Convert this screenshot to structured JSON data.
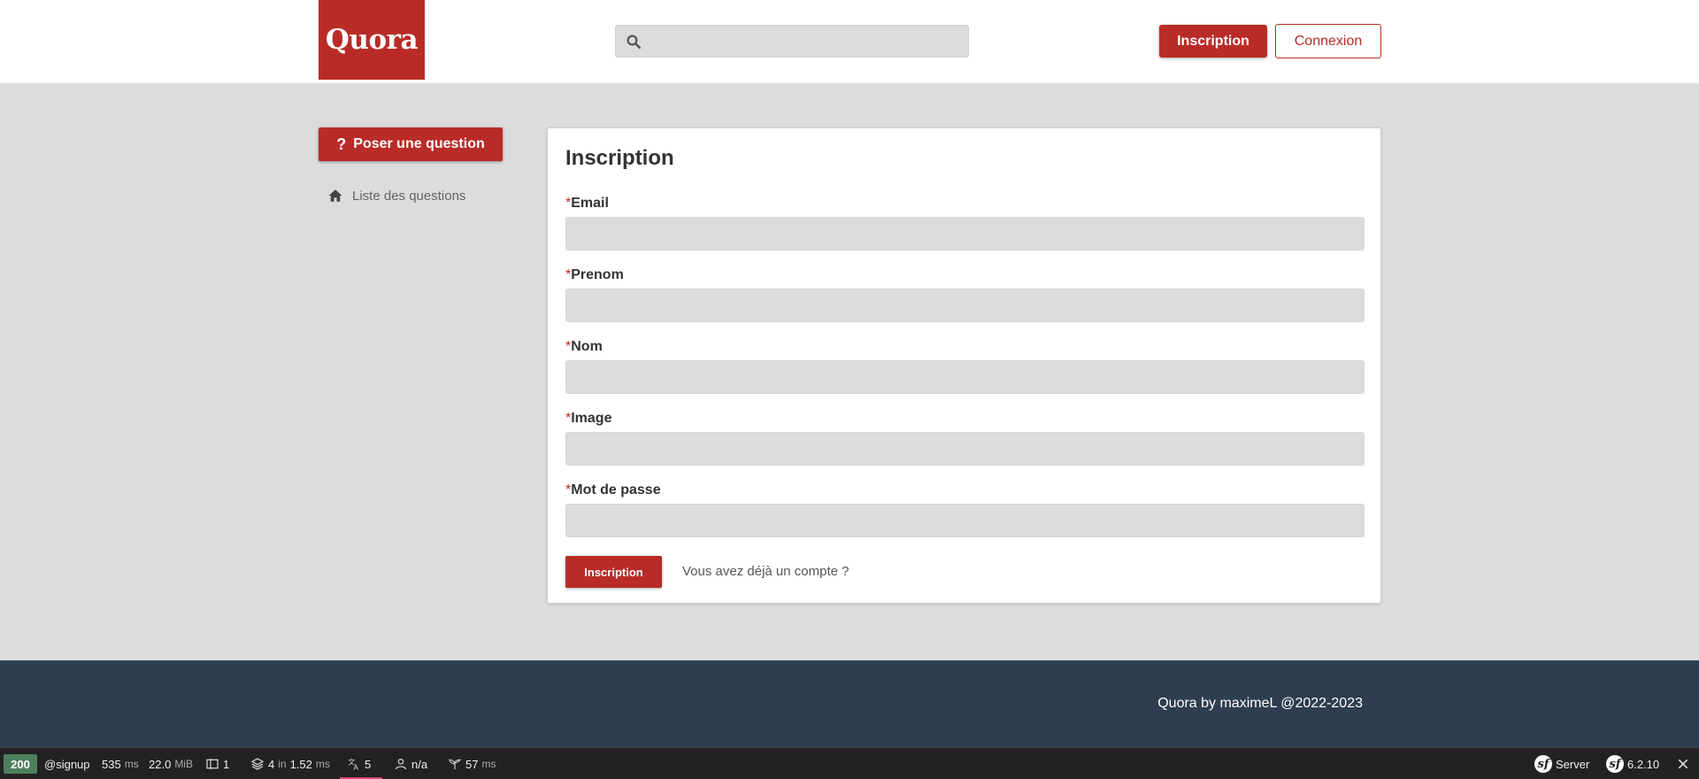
{
  "header": {
    "logo_text": "Quora",
    "search_placeholder": "",
    "signup_label": "Inscription",
    "login_label": "Connexion"
  },
  "sidebar": {
    "ask_question_icon": "?",
    "ask_question_label": "Poser une question",
    "nav_items": [
      {
        "icon": "home-icon",
        "label": "Liste des questions"
      }
    ]
  },
  "form": {
    "title": "Inscription",
    "required_marker": "*",
    "fields": [
      {
        "label": "Email",
        "value": ""
      },
      {
        "label": "Prenom",
        "value": ""
      },
      {
        "label": "Nom",
        "value": ""
      },
      {
        "label": "Image",
        "value": ""
      },
      {
        "label": "Mot de passe",
        "value": ""
      }
    ],
    "submit_label": "Inscription",
    "login_link": "Vous avez déjà un compte ?"
  },
  "footer": {
    "text": "Quora by maximeL @2022-2023"
  },
  "debug_toolbar": {
    "status_code": "200",
    "route": "@signup",
    "time_value": "535",
    "time_unit": "ms",
    "memory_value": "22.0",
    "memory_unit": "MiB",
    "forms_count": "1",
    "doctrine_queries": "4",
    "doctrine_in": "in",
    "doctrine_time": "1.52",
    "doctrine_unit": "ms",
    "translations_count": "5",
    "user": "n/a",
    "twig_time": "57",
    "twig_unit": "ms",
    "server_label": "Server",
    "symfony_version": "6.2.10",
    "colors": {
      "status_ok": "#4f805d",
      "active_underline": "#d9446f"
    }
  },
  "theme": {
    "brand": "#b92b27",
    "footer_bg": "#2e3e50",
    "page_bg": "#dcdcdc"
  }
}
